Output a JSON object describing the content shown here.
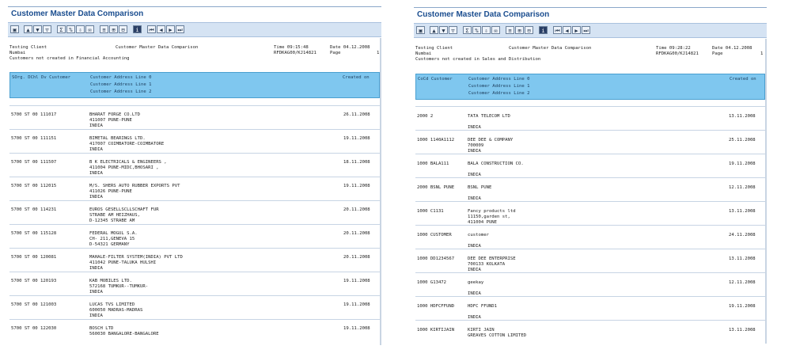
{
  "left": {
    "title": "Customer Master Data Comparison",
    "header": {
      "line1_left": "Testing Client",
      "line1_center": "Customer Master Data Comparison",
      "line1_time": "Time 09:15:48",
      "line1_date": "Date  04.12.2008",
      "line2_left": "Numbai",
      "line2_prog": "RFDKAG00/KJ14821",
      "line2_page": "Page",
      "line2_pagenum": "1",
      "line3": "Customers not created in Financial Accounting"
    },
    "columns": {
      "h1": "SOrg. DChl Dv Customer",
      "h2": "Customer Address Line 0",
      "h3": "Customer Address Line 1",
      "h4": "Customer Address Line 2",
      "created": "Created on"
    },
    "rows": [
      {
        "key": "5700  ST   00 111017",
        "l1": "BHARAT FORGE CO.LTD",
        "l2": "411007 PUNE-PUNE",
        "l3": "INDIA",
        "date": "26.11.2008"
      },
      {
        "key": "5700  ST   00 111151",
        "l1": "BIMETAL BEARINGS LTD.",
        "l2": "417007 COIMBATORE-COIMBATORE",
        "l3": "INDIA",
        "date": "19.11.2008"
      },
      {
        "key": "5700  ST   00 111507",
        "l1": "B K ELECTRICALS & ENGINEERS ,",
        "l2": "411004 PUNE-MIDC,BHOSARI ,",
        "l3": "INDIA",
        "date": "18.11.2008"
      },
      {
        "key": "5700  ST   00 112015",
        "l1": "M/S. SHERS AUTO RUBBER EXPORTS PVT",
        "l2": "411026 PUNE-PUNE",
        "l3": "INDIA",
        "date": "19.11.2008"
      },
      {
        "key": "5700  ST   00 114231",
        "l1": "EUROS GESELLSCLLSCHAFT FUR",
        "l2": "STRABE AM HEIZHAUS,",
        "l3": "D-12345 STRABE AM",
        "date": "20.11.2008"
      },
      {
        "key": "5700  ST   00 115128",
        "l1": "FEDERAL MOGUL S.A.",
        "l2": "CH- 211,GENEVA 15",
        "l3": "D-54321 GERMANY",
        "date": "20.11.2008"
      },
      {
        "key": "5700  ST   00 120081",
        "l1": "MAHALE-FILTER SYSTEM(INDIA) PVT LTD",
        "l2": "411042 PUNE-TALUKA HULSHI",
        "l3": "INDIA",
        "date": "20.11.2008"
      },
      {
        "key": "5700  ST   00 120193",
        "l1": "KAB MOBILES LTD.",
        "l2": "572168 TUMKUR--TUMKUR-",
        "l3": "INDIA",
        "date": "19.11.2008"
      },
      {
        "key": "5700  ST   00 121003",
        "l1": "LUCAS TVS LIMITED",
        "l2": "600050 MADRAS-MADRAS",
        "l3": "INDIA",
        "date": "19.11.2008"
      },
      {
        "key": "5700  ST   00 122030",
        "l1": "BOSCH LTD",
        "l2": "560030 BANGALORE-BANGALORE",
        "l3": "",
        "date": "19.11.2008"
      }
    ]
  },
  "right": {
    "title": "Customer Master Data Comparison",
    "header": {
      "line1_left": "Testing Client",
      "line1_center": "Customer Master Data Comparison",
      "line1_time": "Time 09:28:22",
      "line1_date": "Date  04.12.2008",
      "line2_left": "Numbai",
      "line2_prog": "RFDKAG00/KJ14821",
      "line2_page": "Page",
      "line2_pagenum": "1",
      "line3": "Customers not created in Sales and Distribution"
    },
    "columns": {
      "h1": "CoCd Customer",
      "h2": "Customer Address Line 0",
      "h3": "Customer Address Line 1",
      "h4": "Customer Address Line 2",
      "created": "Created on"
    },
    "rows": [
      {
        "key": "2000 2",
        "l1": "TATA TELECOM LTD",
        "l2": "",
        "l3": "INDIA",
        "date": "13.11.2008"
      },
      {
        "key": "1000 1140A1112",
        "l1": "DEE DEE & COMPANY",
        "l2": "700009",
        "l3": "INDIA",
        "date": "25.11.2008"
      },
      {
        "key": "1000 BALA111",
        "l1": "BALA CONSTRUCTION CO.",
        "l2": "",
        "l3": "INDIA",
        "date": "19.11.2008"
      },
      {
        "key": "2000 BSNL PUNE",
        "l1": "BSNL PUNE",
        "l2": "",
        "l3": "INDIA",
        "date": "12.11.2008"
      },
      {
        "key": "1000 C1131",
        "l1": "Fancy products ltd",
        "l2": "11150,garden st,",
        "l3": "411004 PUNE",
        "date": "13.11.2008"
      },
      {
        "key": "1000 CUSTOMER",
        "l1": "customer",
        "l2": "",
        "l3": "INDIA",
        "date": "24.11.2008"
      },
      {
        "key": "1000 DD1234567",
        "l1": "DEE DEE ENTERPRISE",
        "l2": "700133 KOLKATA",
        "l3": "INDIA",
        "date": "13.11.2008"
      },
      {
        "key": "1000 G13472",
        "l1": "geekay",
        "l2": "",
        "l3": "INDIA",
        "date": "12.11.2008"
      },
      {
        "key": "1000 HDFCFFUND",
        "l1": "HDFC FFUND1",
        "l2": "",
        "l3": "INDIA",
        "date": "19.11.2008"
      },
      {
        "key": "1000 KIRTIJAIN",
        "l1": "KIRTI JAIN",
        "l2": "GREAVES COTTON LIMITED",
        "l3": "",
        "date": "13.11.2008"
      }
    ]
  }
}
